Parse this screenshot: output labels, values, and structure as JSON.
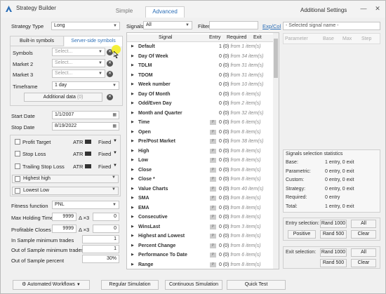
{
  "window": {
    "title": "Strategy Builder"
  },
  "tabs": [
    "Simple",
    "Advanced"
  ],
  "additional_settings_title": "Additional Settings",
  "left": {
    "strategy_type_label": "Strategy Type",
    "strategy_type_value": "Long",
    "symbol_tabs": [
      "Built-in symbols",
      "Server-side symbols"
    ],
    "symbols_label": "Symbols",
    "market2_label": "Market 2",
    "market3_label": "Market 3",
    "select_placeholder": "Select...",
    "timeframe_label": "Timeframe",
    "timeframe_value": "1 day",
    "additional_data_label": "Additional data",
    "additional_data_count": "(0)",
    "start_date_label": "Start Date",
    "start_date_value": "1/1/2007",
    "stop_date_label": "Stop Date",
    "stop_date_value": "8/19/2022",
    "profit_target_label": "Profit Target",
    "stop_loss_label": "Stop Loss",
    "trailing_stop_label": "Trailing Stop Loss",
    "atr_label": "ATR",
    "fixed_label": "Fixed",
    "highest_high_label": "Highest high",
    "lowest_low_label": "Lowest Low",
    "fitness_label": "Fitness function",
    "fitness_value": "PNL",
    "max_holding_label": "Max Holding Time",
    "max_holding_value": "9999",
    "profitable_closes_label": "Profitable Closes",
    "profitable_closes_value": "9999",
    "delta_label": "Δ ×3",
    "delta_value": "0",
    "in_sample_label": "In Sample minimum trades",
    "in_sample_value": "1",
    "oos_trades_label": "Out of Sample minimum trades",
    "oos_trades_value": "1",
    "oos_percent_label": "Out of Sample percent",
    "oos_percent_value": "30%"
  },
  "signals": {
    "label": "Signals",
    "filter_value": "All",
    "filter_label": "Filter",
    "expcol": "Exp/Col",
    "col_signal": "Signal",
    "col_entry": "Entry",
    "col_required": "Required",
    "col_exit": "Exit",
    "rows": [
      {
        "name": "Default",
        "p": false,
        "count": "1 (0)",
        "items": "from 1 item(s)"
      },
      {
        "name": "Day Of Week",
        "p": false,
        "count": "0 (0)",
        "items": "from 34 item(s)"
      },
      {
        "name": "TDLM",
        "p": false,
        "count": "0 (0)",
        "items": "from 31 item(s)"
      },
      {
        "name": "TDOM",
        "p": false,
        "count": "0 (0)",
        "items": "from 31 item(s)"
      },
      {
        "name": "Week number",
        "p": false,
        "count": "0 (0)",
        "items": "from 10 item(s)"
      },
      {
        "name": "Day Of Month",
        "p": false,
        "count": "0 (0)",
        "items": "from 6 item(s)"
      },
      {
        "name": "Odd/Even Day",
        "p": false,
        "count": "0 (0)",
        "items": "from 2 item(s)"
      },
      {
        "name": "Month and Quarter",
        "p": false,
        "count": "0 (0)",
        "items": "from 32 item(s)"
      },
      {
        "name": "Time",
        "p": true,
        "count": "0 (0)",
        "items": "from 6 item(s)"
      },
      {
        "name": "Open",
        "p": true,
        "count": "0 (0)",
        "items": "from 8 item(s)"
      },
      {
        "name": "Pre/Post Market",
        "p": true,
        "count": "0 (0)",
        "items": "from 38 item(s)"
      },
      {
        "name": "High",
        "p": true,
        "count": "0 (0)",
        "items": "from 8 item(s)"
      },
      {
        "name": "Low",
        "p": true,
        "count": "0 (0)",
        "items": "from 8 item(s)"
      },
      {
        "name": "Close",
        "p": true,
        "count": "0 (0)",
        "items": "from 8 item(s)"
      },
      {
        "name": "Close *",
        "p": true,
        "count": "0 (0)",
        "items": "from 8 item(s)"
      },
      {
        "name": "Value Charts",
        "p": true,
        "count": "0 (0)",
        "items": "from 40 item(s)"
      },
      {
        "name": "SMA",
        "p": true,
        "count": "0 (0)",
        "items": "from 8 item(s)"
      },
      {
        "name": "EMA",
        "p": true,
        "count": "0 (0)",
        "items": "from 8 item(s)"
      },
      {
        "name": "Consecutive",
        "p": true,
        "count": "0 (0)",
        "items": "from 8 item(s)"
      },
      {
        "name": "WinsLast",
        "p": true,
        "count": "0 (0)",
        "items": "from 3 item(s)"
      },
      {
        "name": "Highest and Lowest",
        "p": true,
        "count": "0 (0)",
        "items": "from 8 item(s)"
      },
      {
        "name": "Percent Change",
        "p": true,
        "count": "0 (0)",
        "items": "from 8 item(s)"
      },
      {
        "name": "Performance To Date",
        "p": true,
        "count": "0 (0)",
        "items": "from 6 item(s)"
      },
      {
        "name": "Range",
        "p": true,
        "count": "0 (0)",
        "items": "from 8 item(s)"
      }
    ]
  },
  "right": {
    "selected_signal": "- Selected signal name -",
    "param_cols": [
      "Parameter",
      "Base",
      "Max",
      "Step"
    ],
    "stats_title": "Signals selection statistics",
    "stats": [
      {
        "label": "Base:",
        "value": "1 entry, 0 exit"
      },
      {
        "label": "Parametric:",
        "value": "0 entry, 0 exit"
      },
      {
        "label": "Custom:",
        "value": "0 entry, 0 exit"
      },
      {
        "label": "Strategy:",
        "value": "0 entry, 0 exit"
      },
      {
        "label": "Required:",
        "value": "0 entry"
      },
      {
        "label": "Total:",
        "value": "1 entry, 0 exit"
      }
    ],
    "entry_selection_label": "Entry selection:",
    "exit_selection_label": "Exit selection:",
    "rand1000": "Rand 1000",
    "all": "All",
    "positive": "Positive",
    "rand500": "Rand 500",
    "clear": "Clear"
  },
  "bottom": {
    "automated_workflows": "Automated Workflows",
    "regular_simulation": "Regular Simulation",
    "continuous_simulation": "Continuous Simulation",
    "quick_test": "Quick Test"
  },
  "colors": {
    "accent": "#2d6fb7",
    "cursor": "#f5ef18"
  }
}
